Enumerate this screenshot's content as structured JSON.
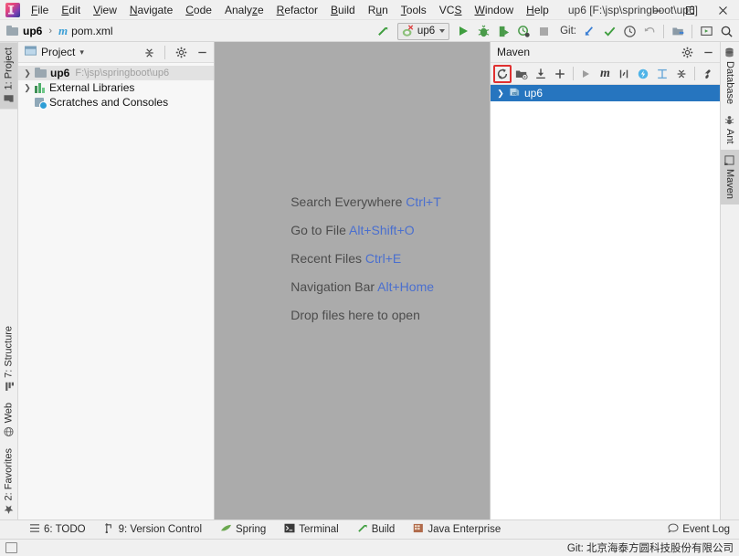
{
  "window": {
    "title": "up6 [F:\\jsp\\springboot\\up6]",
    "minimize": "—",
    "maximize": "☐",
    "close": "✕"
  },
  "menu": {
    "items": [
      {
        "label": "File"
      },
      {
        "label": "Edit"
      },
      {
        "label": "View"
      },
      {
        "label": "Navigate"
      },
      {
        "label": "Code"
      },
      {
        "label": "Analyze"
      },
      {
        "label": "Refactor"
      },
      {
        "label": "Build"
      },
      {
        "label": "Run"
      },
      {
        "label": "Tools"
      },
      {
        "label": "VCS"
      },
      {
        "label": "Window"
      },
      {
        "label": "Help"
      }
    ]
  },
  "breadcrumb": {
    "project": "up6",
    "separator": "›",
    "file": "pom.xml",
    "maven_glyph": "m"
  },
  "toolbar": {
    "build_label": "Build",
    "run_config": "up6",
    "run_label": "Run",
    "debug_label": "Debug",
    "run_coverage_label": "Run with Coverage",
    "profile_label": "Profile",
    "stop_label": "Stop",
    "git_label": "Git:",
    "update_label": "Update Project",
    "commit_label": "Commit",
    "history_label": "History",
    "rollback_label": "Rollback",
    "project_structure_label": "Project Structure",
    "settings_label": "Settings",
    "search_label": "Search"
  },
  "left_stripe": {
    "top": [
      {
        "label": "1: Project",
        "icon": "project-icon",
        "active": true
      }
    ],
    "bottom": [
      {
        "label": "7: Structure",
        "icon": "structure-icon",
        "active": false
      },
      {
        "label": "Web",
        "icon": "web-icon",
        "active": false
      },
      {
        "label": "2: Favorites",
        "icon": "star-icon",
        "active": false
      }
    ]
  },
  "right_stripe": {
    "items": [
      {
        "label": "Database",
        "icon": "database-icon",
        "active": false
      },
      {
        "label": "Ant",
        "icon": "ant-icon",
        "active": false
      },
      {
        "label": "Maven",
        "icon": "maven-icon",
        "active": true
      }
    ]
  },
  "project_panel": {
    "title": "Project",
    "dropdown_glyph": "▾",
    "collapse_all_label": "Collapse All",
    "settings_label": "Settings",
    "hide_label": "Hide",
    "tree": [
      {
        "name": "up6",
        "path": "F:\\jsp\\springboot\\up6",
        "icon": "module-folder-icon",
        "expandable": true,
        "selected": true,
        "indent": 0
      },
      {
        "name": "External Libraries",
        "path": "",
        "icon": "library-icon",
        "expandable": true,
        "selected": false,
        "indent": 0
      },
      {
        "name": "Scratches and Consoles",
        "path": "",
        "icon": "scratches-icon",
        "expandable": false,
        "selected": false,
        "indent": 0
      }
    ]
  },
  "editor": {
    "hints": [
      {
        "action": "Search Everywhere",
        "shortcut": "Ctrl+T"
      },
      {
        "action": "Go to File",
        "shortcut": "Alt+Shift+O"
      },
      {
        "action": "Recent Files",
        "shortcut": "Ctrl+E"
      },
      {
        "action": "Navigation Bar",
        "shortcut": "Alt+Home"
      },
      {
        "action": "Drop files here to open",
        "shortcut": ""
      }
    ]
  },
  "maven_panel": {
    "title": "Maven",
    "settings_label": "Settings",
    "hide_label": "Hide",
    "toolbar": [
      {
        "name": "reload-all-maven-projects-icon",
        "label": "Reload All Maven Projects",
        "highlighted": true
      },
      {
        "name": "generate-sources-icon",
        "label": "Generate Sources and Update Folders",
        "highlighted": false
      },
      {
        "name": "download-sources-icon",
        "label": "Download Sources and/or Documentation",
        "highlighted": false
      },
      {
        "name": "add-maven-project-icon",
        "label": "Add Maven Projects",
        "highlighted": false
      },
      {
        "name": "run-maven-build-icon",
        "label": "Run Maven Build",
        "highlighted": false
      },
      {
        "name": "execute-maven-goal-icon",
        "label": "Execute Maven Goal",
        "highlighted": false
      },
      {
        "name": "toggle-skip-tests-icon",
        "label": "Toggle Skip Tests Mode",
        "highlighted": false
      },
      {
        "name": "toggle-offline-icon",
        "label": "Toggle Offline Mode",
        "highlighted": false
      },
      {
        "name": "show-dependencies-icon",
        "label": "Show Dependencies",
        "highlighted": false
      },
      {
        "name": "collapse-all-icon",
        "label": "Collapse All",
        "highlighted": false
      },
      {
        "name": "maven-settings-icon",
        "label": "Maven Settings",
        "highlighted": false
      }
    ],
    "tree": [
      {
        "name": "up6",
        "icon": "maven-project-icon",
        "expandable": true,
        "selected": true
      }
    ]
  },
  "tool_windows": {
    "items": [
      {
        "label": "6: TODO",
        "icon": "todo-icon"
      },
      {
        "label": "9: Version Control",
        "icon": "vcs-icon"
      },
      {
        "label": "Spring",
        "icon": "spring-icon"
      },
      {
        "label": "Terminal",
        "icon": "terminal-icon"
      },
      {
        "label": "Build",
        "icon": "build-icon"
      },
      {
        "label": "Java Enterprise",
        "icon": "java-enterprise-icon"
      }
    ],
    "event_log": "Event Log"
  },
  "status_bar": {
    "git_branch": "Git: 北京海泰方圆科技股份有限公司"
  },
  "colors": {
    "accent_blue": "#2675bf",
    "link_blue": "#4a6fcf",
    "highlight_red": "#e03030",
    "editor_bg": "#ababab",
    "panel_bg": "#f0f0f0"
  }
}
